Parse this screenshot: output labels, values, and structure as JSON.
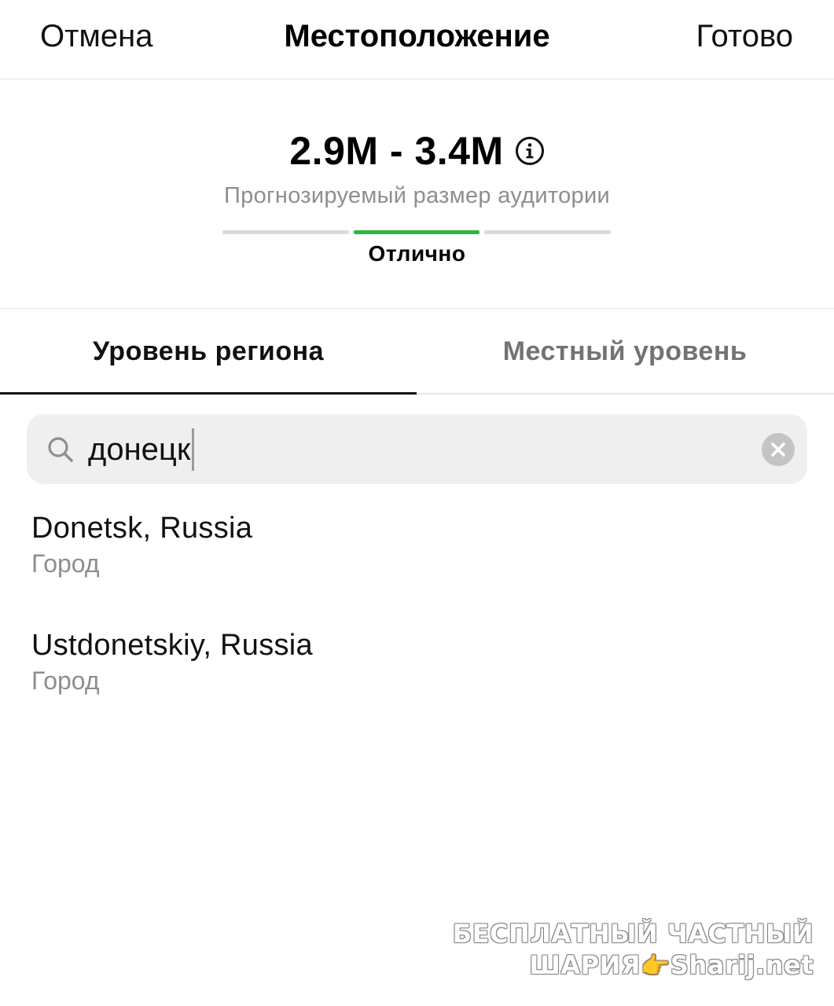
{
  "header": {
    "cancel_label": "Отмена",
    "title": "Местоположение",
    "done_label": "Готово"
  },
  "audience": {
    "range": "2.9M - 3.4M",
    "label": "Прогнозируемый размер аудитории",
    "meter_label": "Отлично",
    "meter_active_segment": 2,
    "meter_segments": 3,
    "meter_color": "#2db742"
  },
  "tabs": [
    {
      "label": "Уровень региона",
      "active": true
    },
    {
      "label": "Местный уровень",
      "active": false
    }
  ],
  "search": {
    "value": "донецк"
  },
  "results": [
    {
      "title": "Donetsk, Russia",
      "subtitle": "Город"
    },
    {
      "title": "Ustdonetskiy, Russia",
      "subtitle": "Город"
    }
  ],
  "watermark": {
    "line1": "БЕСПЛАТНЫЙ ЧАСТНЫЙ",
    "line2_left": "ШАРИЯ",
    "hand": "👉",
    "line2_right": "Sharij.net"
  }
}
